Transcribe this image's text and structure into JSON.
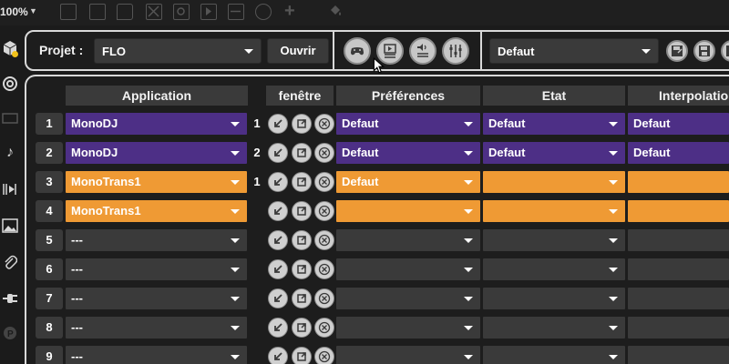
{
  "toolbar": {
    "zoom": "100%"
  },
  "project": {
    "label": "Projet :",
    "value": "FLO",
    "open_label": "Ouvrir"
  },
  "state": {
    "value": "Defaut"
  },
  "columns": {
    "application": "Application",
    "window": "fenêtre",
    "preferences": "Préférences",
    "state": "Etat",
    "interpolation": "Interpolatio"
  },
  "rows": [
    {
      "num": "1",
      "app": "MonoDJ",
      "win": "1",
      "pref": "Defaut",
      "etat": "Defaut",
      "interp": "Defaut",
      "color": "purple"
    },
    {
      "num": "2",
      "app": "MonoDJ",
      "win": "2",
      "pref": "Defaut",
      "etat": "Defaut",
      "interp": "Defaut",
      "color": "purple"
    },
    {
      "num": "3",
      "app": "MonoTrans1",
      "win": "1",
      "pref": "Defaut",
      "etat": "",
      "interp": "",
      "color": "orange"
    },
    {
      "num": "4",
      "app": "MonoTrans1",
      "win": "",
      "pref": "",
      "etat": "",
      "interp": "",
      "color": "orange"
    },
    {
      "num": "5",
      "app": "---",
      "win": "",
      "pref": "",
      "etat": "",
      "interp": "",
      "color": "gray"
    },
    {
      "num": "6",
      "app": "---",
      "win": "",
      "pref": "",
      "etat": "",
      "interp": "",
      "color": "gray"
    },
    {
      "num": "7",
      "app": "---",
      "win": "",
      "pref": "",
      "etat": "",
      "interp": "",
      "color": "gray"
    },
    {
      "num": "8",
      "app": "---",
      "win": "",
      "pref": "",
      "etat": "",
      "interp": "",
      "color": "gray"
    },
    {
      "num": "9",
      "app": "---",
      "win": "",
      "pref": "",
      "etat": "",
      "interp": "",
      "color": "gray"
    }
  ],
  "colors": {
    "purple": "#4d2f86",
    "orange": "#ef9a34",
    "gray": "#3a3a3a",
    "accent": "#f2c21b"
  },
  "icons": {
    "header_buttons": [
      "gamepad-icon",
      "media-settings-icon",
      "audio-settings-icon",
      "mixer-icon"
    ],
    "right_buttons": [
      "save-as-icon",
      "save-icon",
      "more-icon"
    ],
    "window_buttons": [
      "minimize-window-icon",
      "maximize-window-icon",
      "close-window-icon"
    ]
  }
}
